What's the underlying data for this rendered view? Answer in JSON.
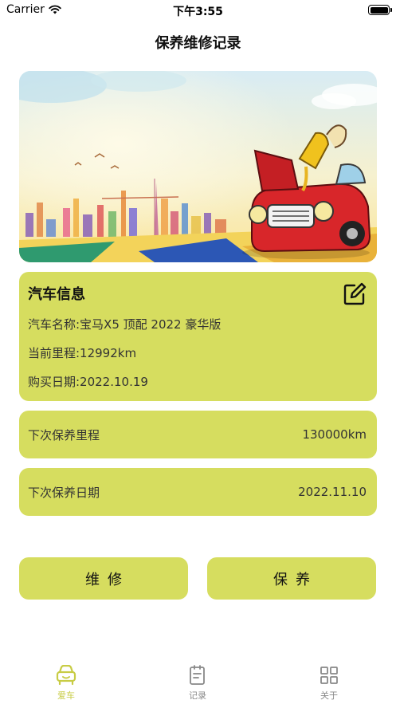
{
  "status_bar": {
    "carrier": "Carrier",
    "time": "下午3:55"
  },
  "header": {
    "title": "保养维修记录"
  },
  "car_info": {
    "title": "汽车信息",
    "name_line": "汽车名称:宝马X5 顶配 2022 豪华版",
    "mileage_line": "当前里程:12992km",
    "purchase_line": "购买日期:2022.10.19"
  },
  "next_mileage": {
    "label": "下次保养里程",
    "value": "130000km"
  },
  "next_date": {
    "label": "下次保养日期",
    "value": "2022.11.10"
  },
  "actions": {
    "repair_label": "维修",
    "maintain_label": "保养"
  },
  "tabbar": {
    "tabs": [
      {
        "label": "爱车",
        "icon": "car-icon",
        "active": true
      },
      {
        "label": "记录",
        "icon": "record-icon",
        "active": false
      },
      {
        "label": "关于",
        "icon": "grid-icon",
        "active": false
      }
    ]
  },
  "colors": {
    "accent": "#d6dd5f",
    "active_tab": "#c8cc45"
  }
}
